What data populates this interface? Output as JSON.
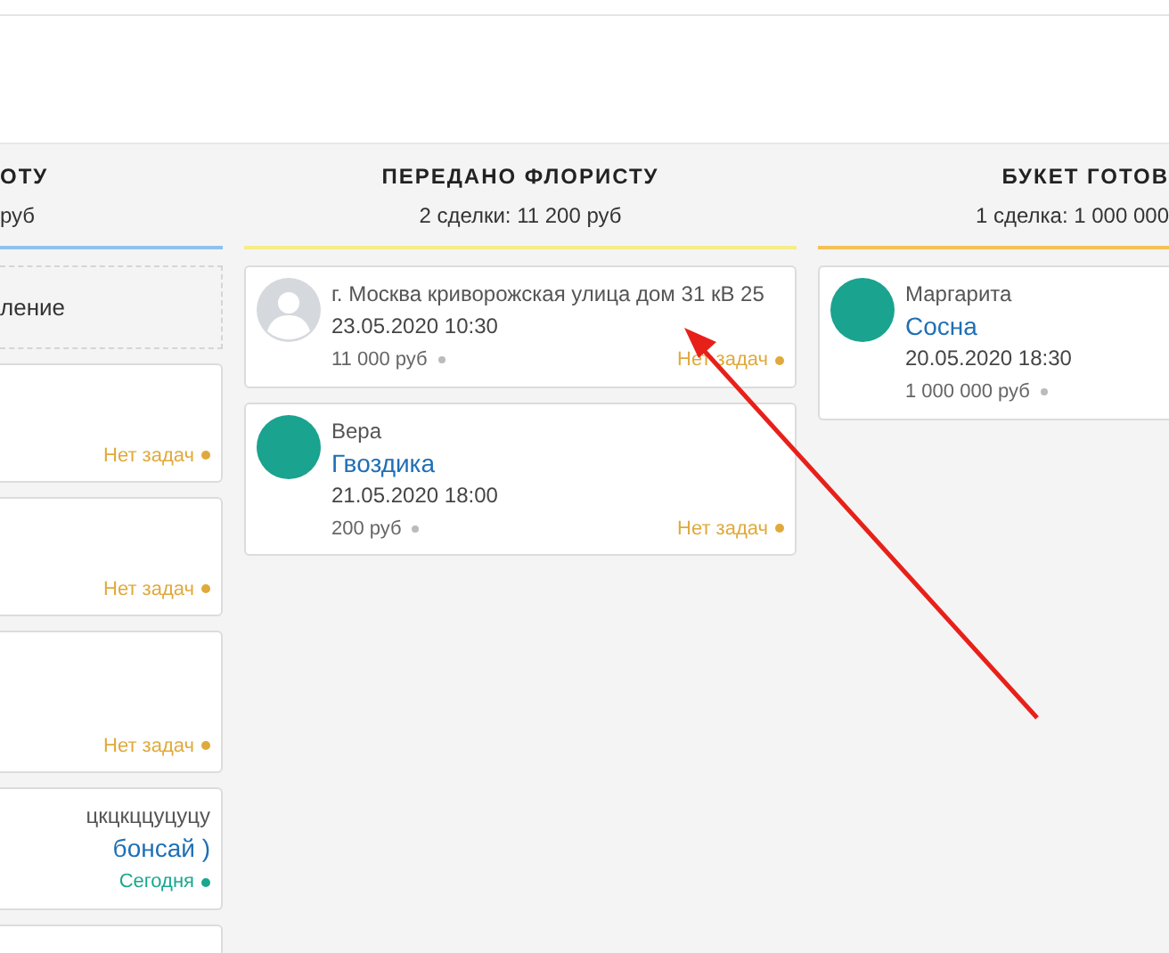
{
  "columns": [
    {
      "kind": "cut_left",
      "title": "ОТУ",
      "subtitle": "руб",
      "color": "#8fc1f0",
      "cards": [
        {
          "kind": "add",
          "text": "ление"
        },
        {
          "kind": "deal",
          "tasks": {
            "text": "Нет задач",
            "color": "#e0a93b"
          }
        },
        {
          "kind": "deal",
          "tasks": {
            "text": "Нет задач",
            "color": "#e0a93b"
          }
        },
        {
          "kind": "deal",
          "tall": true,
          "tasks": {
            "text": "Нет задач",
            "color": "#e0a93b"
          }
        },
        {
          "kind": "deal",
          "contact": "цкцкццуцуцу",
          "product": "бонсай )",
          "tasks": {
            "text": "Сегодня",
            "color": "#1aa78f"
          }
        },
        {
          "kind": "deal"
        }
      ]
    },
    {
      "kind": "full",
      "title": "ПЕРЕДАНО ФЛОРИСТУ",
      "subtitle": "2 сделки: 11 200 руб",
      "color": "#f5ec8a",
      "cards": [
        {
          "kind": "deal",
          "avatar": {
            "kind": "placeholder"
          },
          "contact": "г. Москва криворожская улица дом 31 кВ 25",
          "date": "23.05.2020 10:30",
          "amount": "11 000 руб",
          "tasks": {
            "text": "Нет задач",
            "color": "#e0a93b"
          }
        },
        {
          "kind": "deal",
          "avatar": {
            "kind": "filled"
          },
          "contact": "Вера",
          "product": "Гвоздика",
          "date": "21.05.2020 18:00",
          "amount": "200 руб",
          "tasks": {
            "text": "Нет задач",
            "color": "#e0a93b"
          }
        }
      ]
    },
    {
      "kind": "cut_right",
      "title": "БУКЕТ ГОТОВ",
      "subtitle": "1 сделка: 1 000 000",
      "color": "#f5c057",
      "cards": [
        {
          "kind": "deal",
          "avatar": {
            "kind": "filled"
          },
          "contact": "Маргарита",
          "product": "Сосна",
          "date": "20.05.2020 18:30",
          "amount": "1 000 000 руб"
        }
      ]
    }
  ]
}
